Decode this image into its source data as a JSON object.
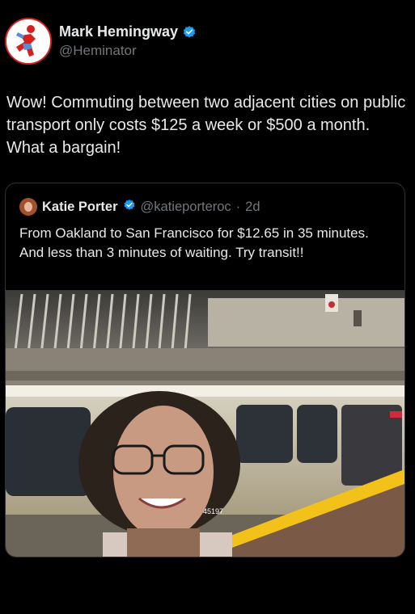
{
  "author": {
    "name": "Mark Hemingway",
    "handle": "@Heminator"
  },
  "tweet": {
    "text": "Wow! Commuting between two adjacent cities on public transport only costs $125 a week or $500 a month. What a bargain!"
  },
  "quoted_tweet": {
    "name": "Katie Porter",
    "handle": "@katieporteroc",
    "separator": "·",
    "age": "2d",
    "text": "From Oakland to San Francisco for $12.65 in 35 minutes. And less than 3 minutes of waiting. Try transit!!"
  },
  "photo": {
    "train_number": "45197"
  },
  "colors": {
    "background": "#000000",
    "text_primary": "#e7e9ea",
    "text_secondary": "#71767b",
    "verified_badge": "#1d9bf0",
    "border": "#2f3336"
  },
  "icons": {
    "verified": "verified-badge-icon"
  }
}
